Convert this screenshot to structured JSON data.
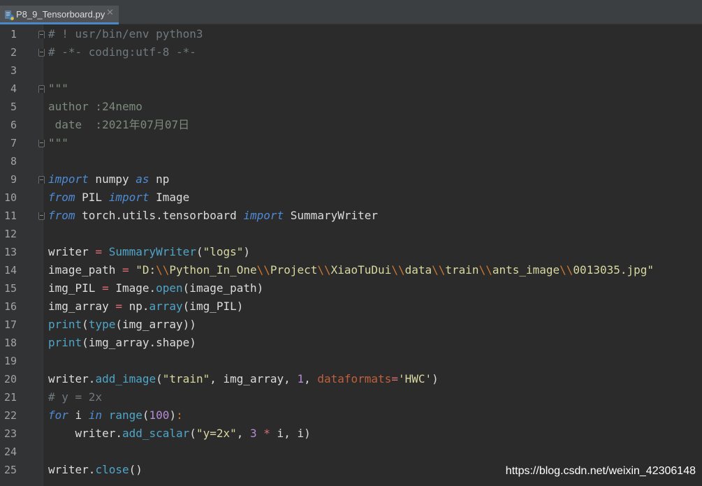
{
  "tab": {
    "filename": "P8_9_Tensorboard.py",
    "close_glyph": "✕",
    "icon": "python-file-icon"
  },
  "line_numbers": [
    "1",
    "2",
    "3",
    "4",
    "5",
    "6",
    "7",
    "8",
    "9",
    "10",
    "11",
    "12",
    "13",
    "14",
    "15",
    "16",
    "17",
    "18",
    "19",
    "20",
    "21",
    "22",
    "23",
    "24",
    "25"
  ],
  "code_lines": [
    [
      [
        "cmt",
        "# ! usr/bin/env python3"
      ]
    ],
    [
      [
        "cmt",
        "# -*- coding:utf-8 -*-"
      ]
    ],
    [],
    [
      [
        "doc",
        "\"\"\""
      ]
    ],
    [
      [
        "doc",
        "author :24nemo"
      ]
    ],
    [
      [
        "doc",
        " date  :2021年07月07日"
      ]
    ],
    [
      [
        "doc",
        "\"\"\""
      ]
    ],
    [],
    [
      [
        "imp",
        "import"
      ],
      [
        "plain",
        " numpy "
      ],
      [
        "imp",
        "as"
      ],
      [
        "plain",
        " np"
      ]
    ],
    [
      [
        "imp",
        "from"
      ],
      [
        "plain",
        " PIL "
      ],
      [
        "imp",
        "import"
      ],
      [
        "plain",
        " Image"
      ]
    ],
    [
      [
        "imp",
        "from"
      ],
      [
        "plain",
        " torch.utils.tensorboard "
      ],
      [
        "imp",
        "import"
      ],
      [
        "plain",
        " SummaryWriter"
      ]
    ],
    [],
    [
      [
        "plain",
        "writer "
      ],
      [
        "op",
        "="
      ],
      [
        "plain",
        " "
      ],
      [
        "fn",
        "SummaryWriter"
      ],
      [
        "plain",
        "("
      ],
      [
        "str",
        "\"logs\""
      ],
      [
        "plain",
        ")"
      ]
    ],
    [
      [
        "plain",
        "image_path "
      ],
      [
        "op",
        "="
      ],
      [
        "plain",
        " "
      ],
      [
        "str",
        "\"D:"
      ],
      [
        "esc",
        "\\\\"
      ],
      [
        "str",
        "Python_In_One"
      ],
      [
        "esc",
        "\\\\"
      ],
      [
        "str",
        "Project"
      ],
      [
        "esc",
        "\\\\"
      ],
      [
        "str",
        "XiaoTuDui"
      ],
      [
        "esc",
        "\\\\"
      ],
      [
        "str",
        "data"
      ],
      [
        "esc",
        "\\\\"
      ],
      [
        "str",
        "train"
      ],
      [
        "esc",
        "\\\\"
      ],
      [
        "str",
        "ants_image"
      ],
      [
        "esc",
        "\\\\"
      ],
      [
        "str",
        "0013035.jpg\""
      ]
    ],
    [
      [
        "plain",
        "img_PIL "
      ],
      [
        "op",
        "="
      ],
      [
        "plain",
        " Image."
      ],
      [
        "fn",
        "open"
      ],
      [
        "plain",
        "(image_path)"
      ]
    ],
    [
      [
        "plain",
        "img_array "
      ],
      [
        "op",
        "="
      ],
      [
        "plain",
        " np."
      ],
      [
        "fn",
        "array"
      ],
      [
        "plain",
        "(img_PIL)"
      ]
    ],
    [
      [
        "fn",
        "print"
      ],
      [
        "plain",
        "("
      ],
      [
        "fn",
        "type"
      ],
      [
        "plain",
        "(img_array))"
      ]
    ],
    [
      [
        "fn",
        "print"
      ],
      [
        "plain",
        "(img_array.shape)"
      ]
    ],
    [],
    [
      [
        "plain",
        "writer."
      ],
      [
        "fn",
        "add_image"
      ],
      [
        "plain",
        "("
      ],
      [
        "str",
        "\"train\""
      ],
      [
        "plain",
        ", img_array, "
      ],
      [
        "num",
        "1"
      ],
      [
        "plain",
        ", "
      ],
      [
        "param",
        "dataformats"
      ],
      [
        "op",
        "="
      ],
      [
        "str",
        "'HWC'"
      ],
      [
        "plain",
        ")"
      ]
    ],
    [
      [
        "cmt",
        "# y = 2x"
      ]
    ],
    [
      [
        "imp",
        "for"
      ],
      [
        "plain",
        " i "
      ],
      [
        "imp",
        "in"
      ],
      [
        "plain",
        " "
      ],
      [
        "fn",
        "range"
      ],
      [
        "plain",
        "("
      ],
      [
        "num",
        "100"
      ],
      [
        "plain",
        ")"
      ],
      [
        "kw",
        ":"
      ]
    ],
    [
      [
        "plain",
        "    writer."
      ],
      [
        "fn",
        "add_scalar"
      ],
      [
        "plain",
        "("
      ],
      [
        "str",
        "\"y=2x\""
      ],
      [
        "plain",
        ", "
      ],
      [
        "num",
        "3"
      ],
      [
        "plain",
        " "
      ],
      [
        "op",
        "*"
      ],
      [
        "plain",
        " i, i)"
      ]
    ],
    [],
    [
      [
        "plain",
        "writer."
      ],
      [
        "fn",
        "close"
      ],
      [
        "plain",
        "()"
      ]
    ]
  ],
  "folds": [
    {
      "line": 1,
      "kind": "open"
    },
    {
      "line": 2,
      "kind": "close"
    },
    {
      "line": 4,
      "kind": "open"
    },
    {
      "line": 7,
      "kind": "close"
    },
    {
      "line": 9,
      "kind": "open"
    },
    {
      "line": 11,
      "kind": "close"
    }
  ],
  "watermark": "https://blog.csdn.net/weixin_42306148"
}
